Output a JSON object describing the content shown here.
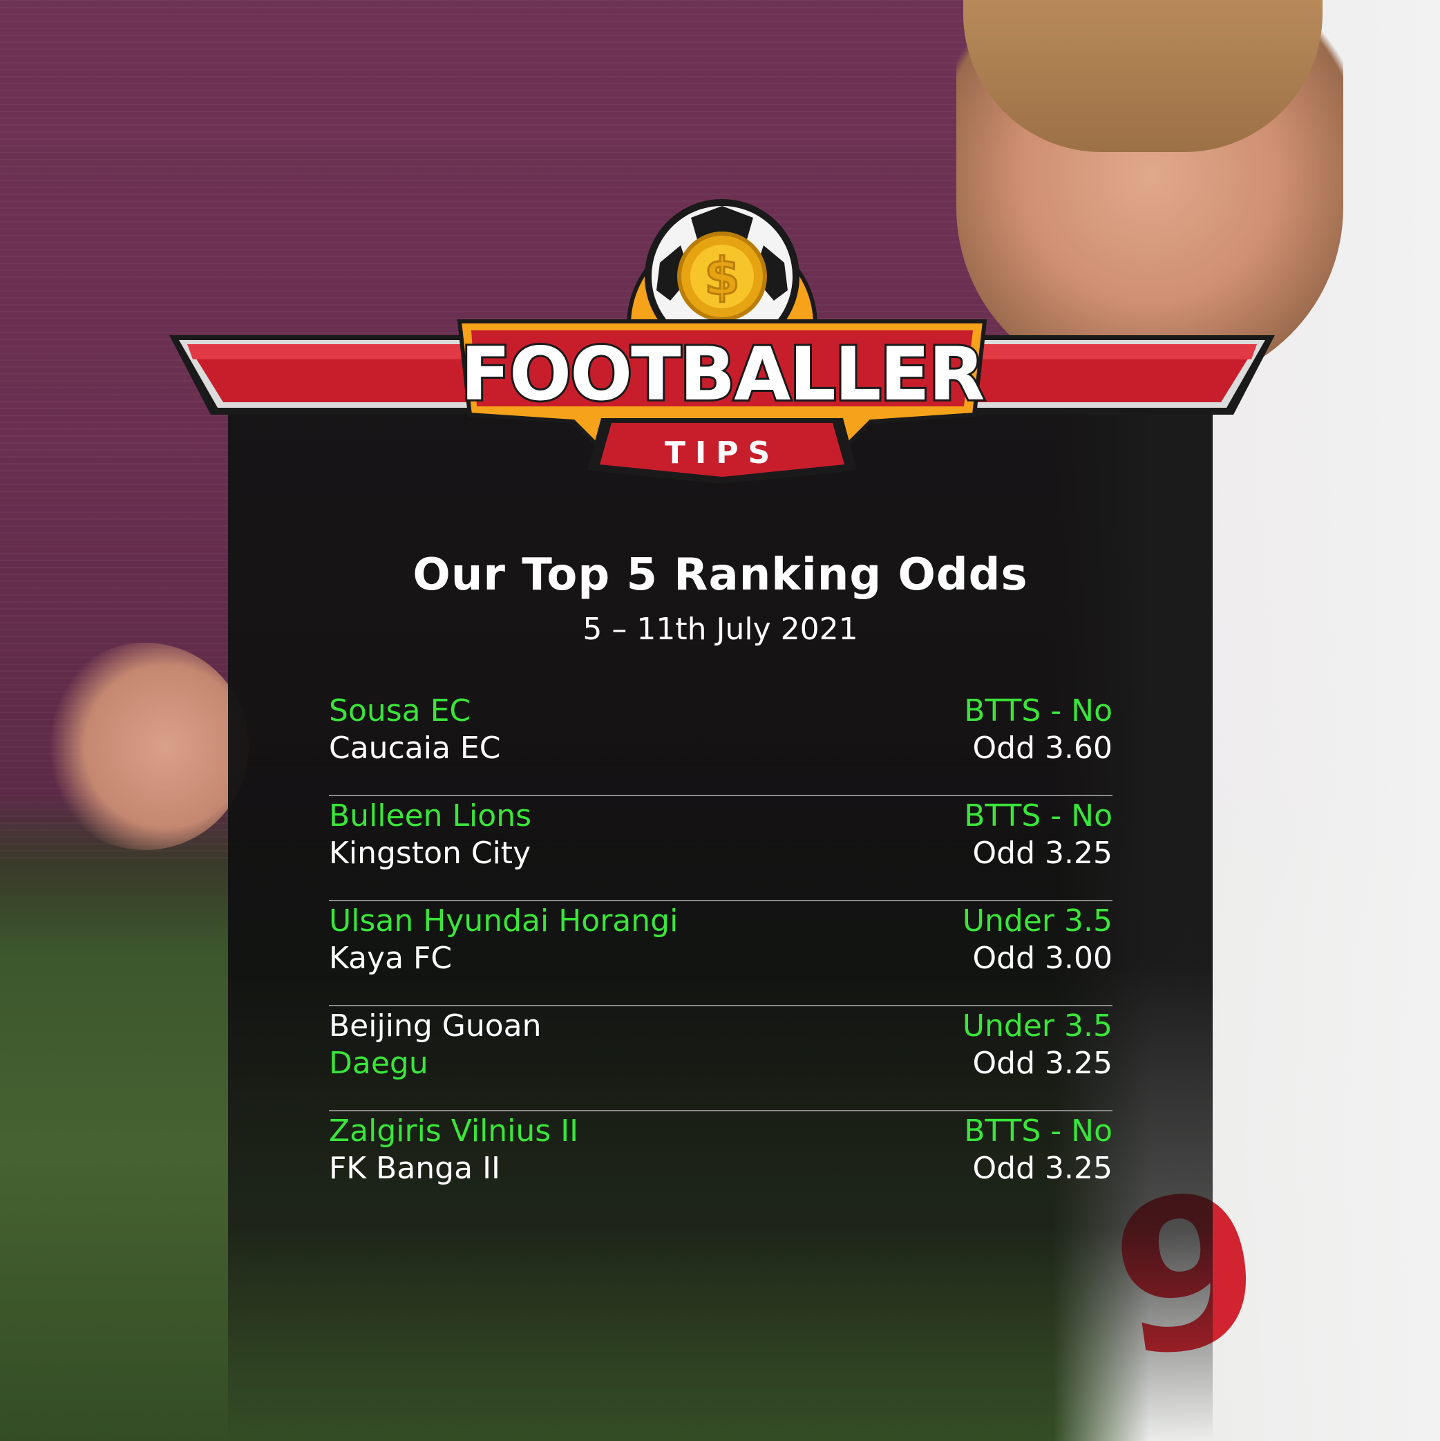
{
  "brand": {
    "name_line1": "FOOTBALLER",
    "name_line2": "TIPS",
    "coin_symbol": "$",
    "colors": {
      "red": "#d0202e",
      "orange": "#f6a21a",
      "gold": "#f7c52a",
      "dark": "#1a1a1a"
    }
  },
  "header": {
    "title": "Our Top 5 Ranking Odds",
    "date_range": "5 – 11th July 2021"
  },
  "background": {
    "shirt_number": "9"
  },
  "tips": [
    {
      "team1": "Sousa EC",
      "team2": "Caucaia EC",
      "highlight": "team1",
      "market": "BTTS - No",
      "odd": "Odd 3.60"
    },
    {
      "team1": "Bulleen Lions",
      "team2": "Kingston City",
      "highlight": "team1",
      "market": "BTTS - No",
      "odd": "Odd 3.25"
    },
    {
      "team1": "Ulsan Hyundai Horangi",
      "team2": "Kaya FC",
      "highlight": "team1",
      "market": "Under 3.5",
      "odd": "Odd 3.00"
    },
    {
      "team1": "Beijing Guoan",
      "team2": "Daegu",
      "highlight": "team2",
      "market": "Under 3.5",
      "odd": "Odd 3.25"
    },
    {
      "team1": "Zalgiris Vilnius II",
      "team2": "FK Banga II",
      "highlight": "team1",
      "market": "BTTS - No",
      "odd": "Odd 3.25"
    }
  ]
}
